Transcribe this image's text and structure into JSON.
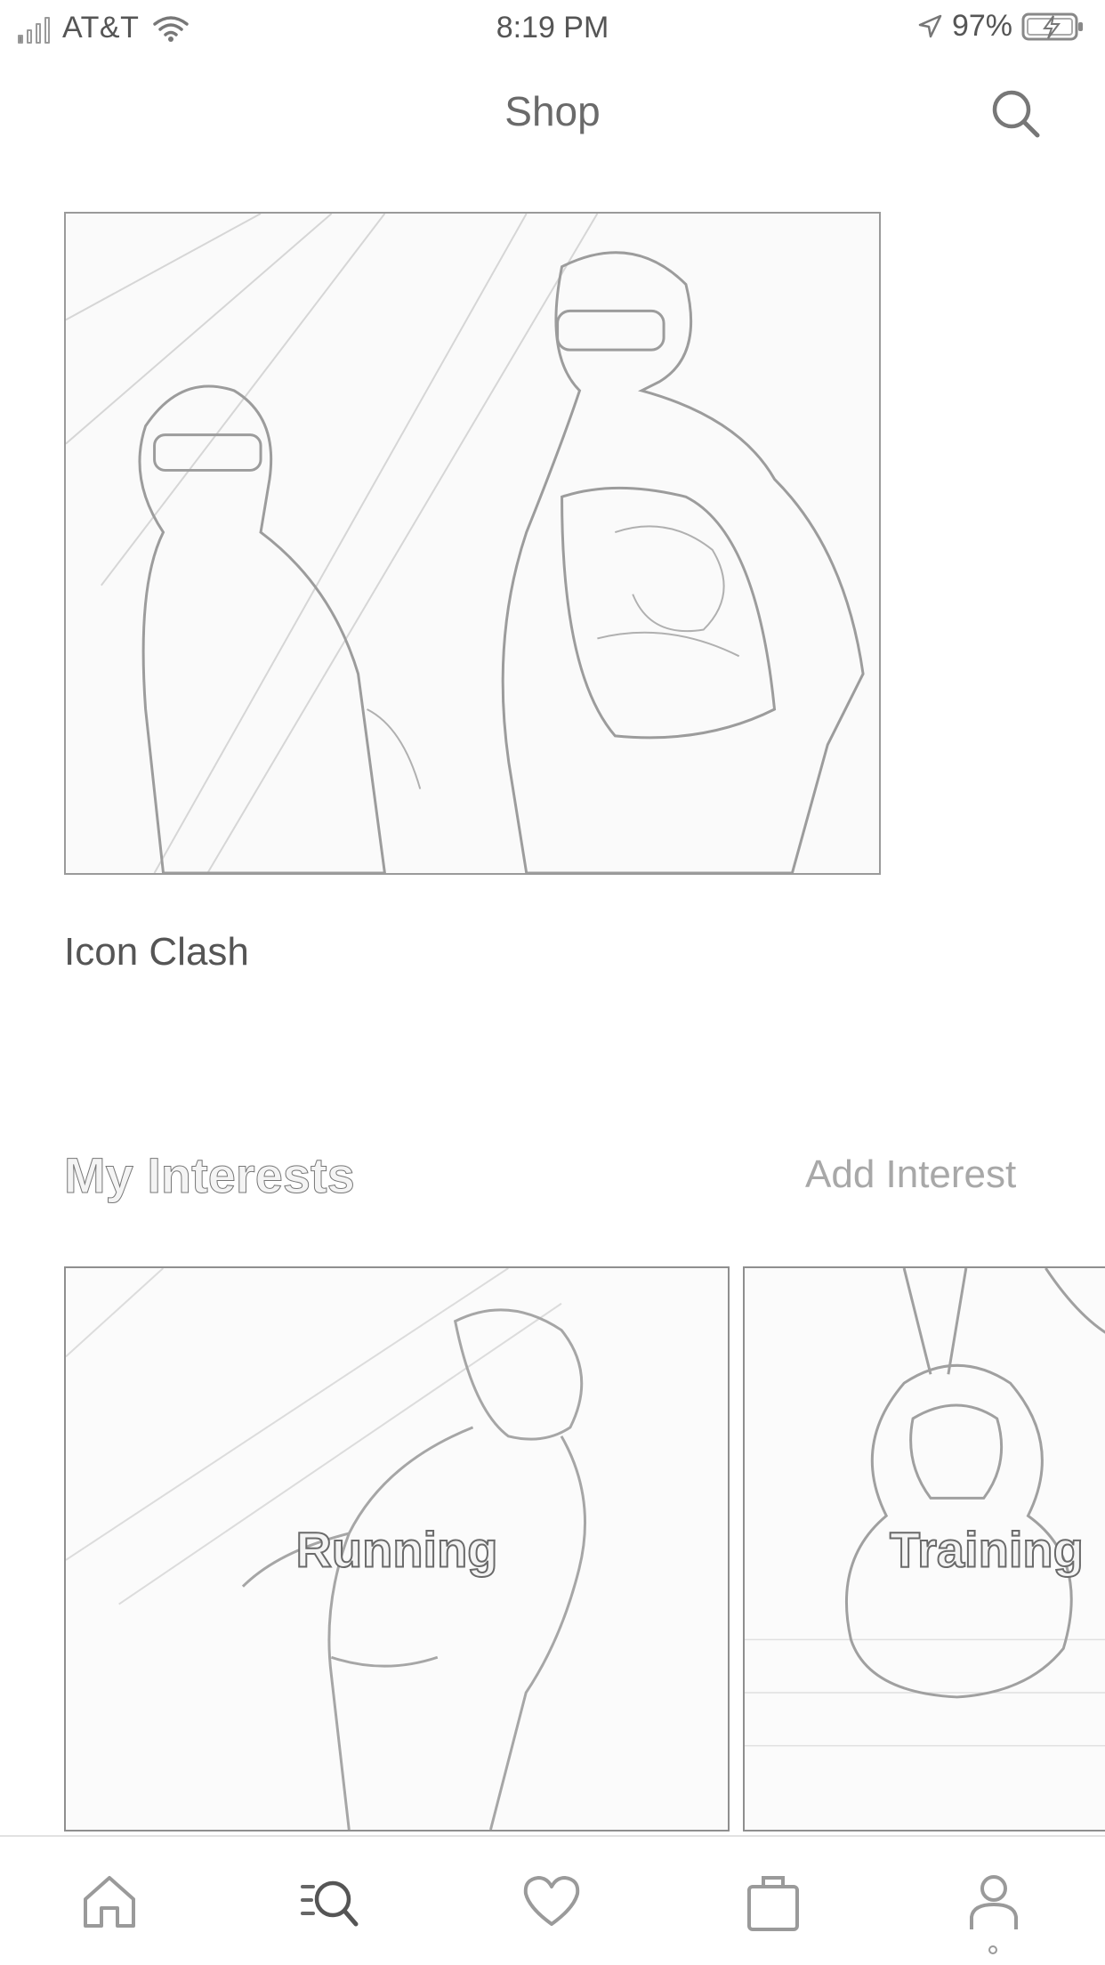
{
  "status_bar": {
    "carrier": "AT&T",
    "time": "8:19 PM",
    "battery": "97%",
    "icons": [
      "signal-icon",
      "wifi-icon",
      "location-arrow-icon",
      "battery-charging-icon"
    ]
  },
  "header": {
    "title": "Shop",
    "search_icon": "search-icon"
  },
  "feature": {
    "title": "Icon Clash"
  },
  "interests": {
    "heading": "My Interests",
    "add_label": "Add Interest",
    "cards": [
      {
        "label": "Running"
      },
      {
        "label": "Training"
      }
    ]
  },
  "tab_bar": {
    "items": [
      "home-icon",
      "shop-search-icon",
      "heart-icon",
      "bag-icon",
      "profile-icon"
    ],
    "active": "shop-search-icon"
  }
}
